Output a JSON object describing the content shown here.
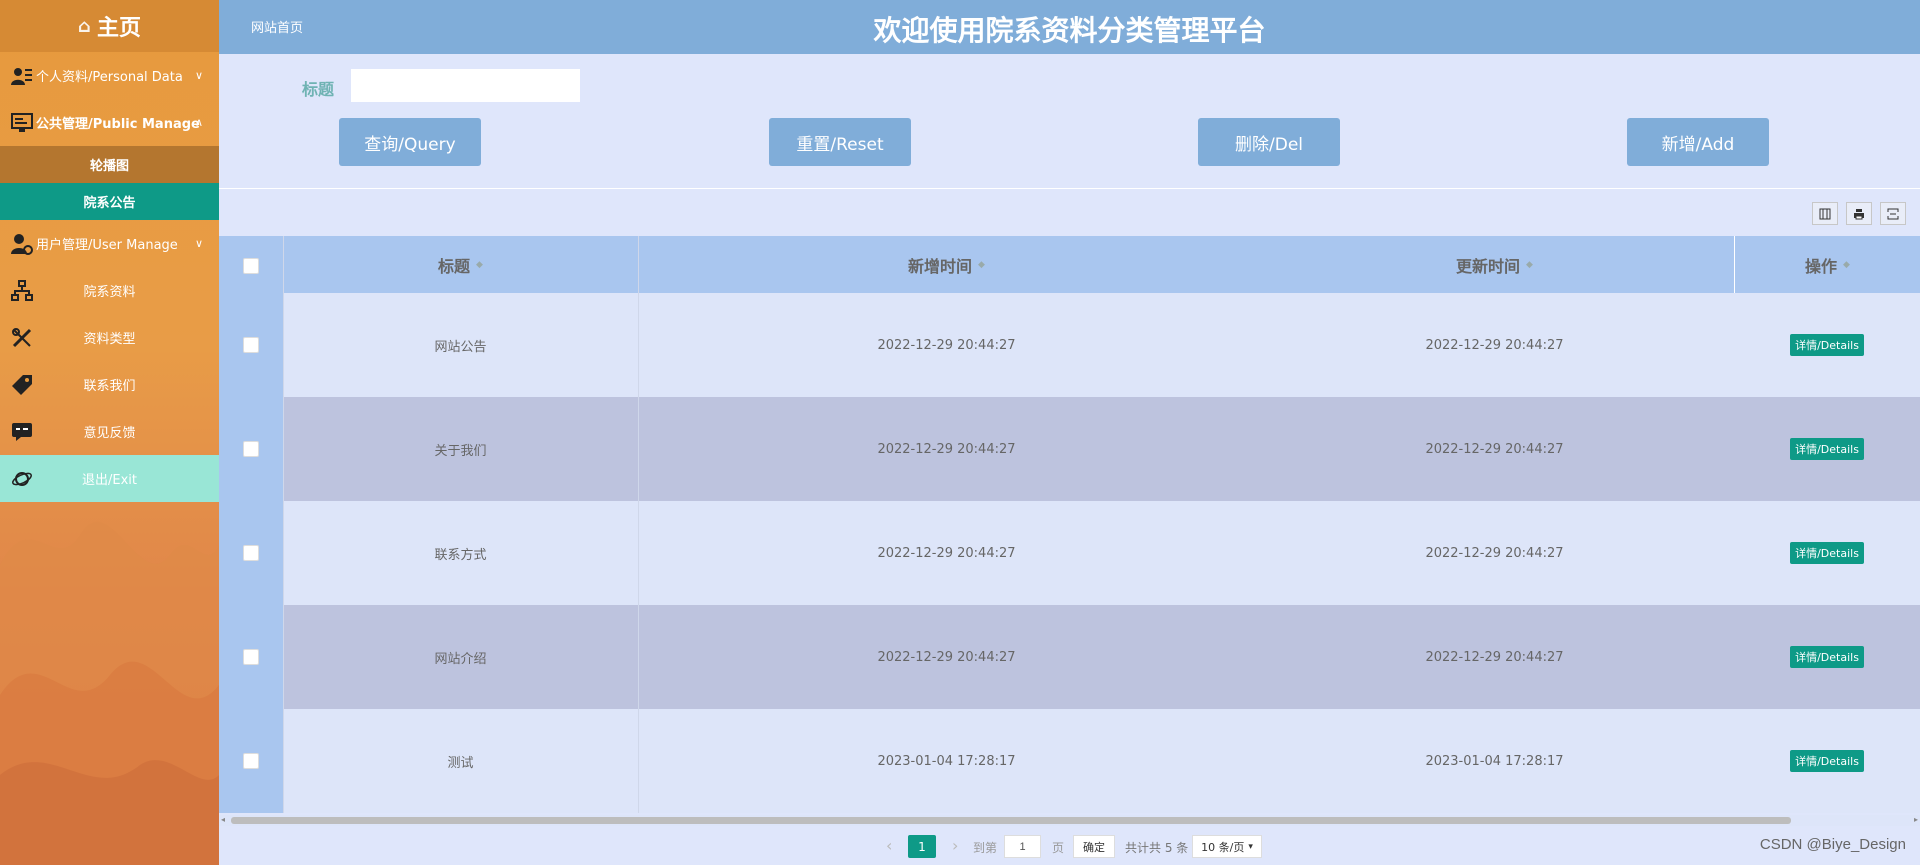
{
  "sidebar": {
    "logo": "主页",
    "items": [
      {
        "label": "个人资料/Personal Data",
        "chevron": "∨",
        "icon": "id-card-icon"
      },
      {
        "label": "公共管理/Public Manage",
        "chevron": "∧",
        "icon": "monitor-icon"
      },
      {
        "label": "轮播图"
      },
      {
        "label": "院系公告"
      },
      {
        "label": "用户管理/User Manage",
        "chevron": "∨",
        "icon": "user-gear-icon"
      },
      {
        "label": "院系资料",
        "icon": "sitemap-icon"
      },
      {
        "label": "资料类型",
        "icon": "tools-icon"
      },
      {
        "label": "联系我们",
        "icon": "tag-icon"
      },
      {
        "label": "意见反馈",
        "icon": "chat-icon"
      },
      {
        "label": "退出/Exit",
        "icon": "planet-icon"
      }
    ]
  },
  "header": {
    "breadcrumb": "网站首页",
    "title": "欢迎使用院系资料分类管理平台"
  },
  "search": {
    "label": "标题",
    "value": ""
  },
  "buttons": {
    "query": "查询/Query",
    "reset": "重置/Reset",
    "delete": "删除/Del",
    "add": "新增/Add"
  },
  "table": {
    "headers": [
      "标题",
      "新增时间",
      "更新时间",
      "操作"
    ],
    "sort_icon": "◆",
    "rows": [
      {
        "title": "网站公告",
        "created": "2022-12-29 20:44:27",
        "updated": "2022-12-29 20:44:27",
        "action": "详情/Details"
      },
      {
        "title": "关于我们",
        "created": "2022-12-29 20:44:27",
        "updated": "2022-12-29 20:44:27",
        "action": "详情/Details"
      },
      {
        "title": "联系方式",
        "created": "2022-12-29 20:44:27",
        "updated": "2022-12-29 20:44:27",
        "action": "详情/Details"
      },
      {
        "title": "网站介绍",
        "created": "2022-12-29 20:44:27",
        "updated": "2022-12-29 20:44:27",
        "action": "详情/Details"
      },
      {
        "title": "测试",
        "created": "2023-01-04 17:28:17",
        "updated": "2023-01-04 17:28:17",
        "action": "详情/Details"
      }
    ]
  },
  "pagination": {
    "prev": "‹",
    "current": "1",
    "next": "›",
    "goto_label": "到第",
    "goto_value": "1",
    "page_suffix": "页",
    "confirm": "确定",
    "total": "共计共 5 条",
    "page_size": "10 条/页"
  },
  "watermark": "CSDN @Biye_Design",
  "colors": {
    "sidebar": "#e79a3d",
    "header": "#80add9",
    "accent": "#0e9a87",
    "exit": "#99e6d6"
  }
}
